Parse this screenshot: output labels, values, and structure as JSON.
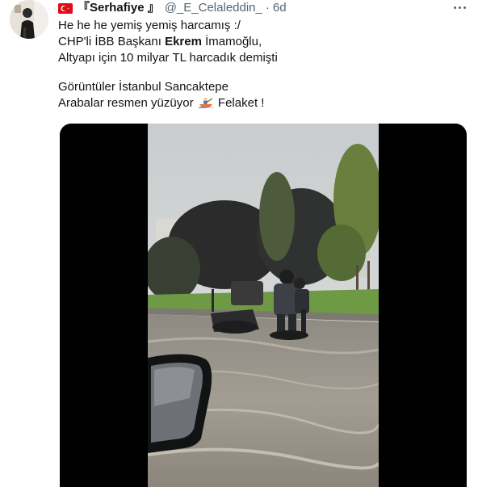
{
  "tweet": {
    "display_name": "『Serhafiye 』",
    "handle": "@_E_Celaleddin_",
    "separator": "·",
    "timestamp": "6d",
    "flag_icon": "turkey-flag-icon",
    "text_lines": {
      "l1": "He he he yemiş yemiş harcamış :/",
      "l2_pre": "CHP'li İBB Başkanı ",
      "l2_bold": "Ekrem",
      "l2_post": " İmamoğlu,",
      "l3": "Altyapı için 10 milyar TL harcadık demişti",
      "l4": "Görüntüler İstanbul Sancaktepe",
      "l5_pre": "Arabalar resmen yüzüyor ",
      "l5_emoji": "rowboat-emoji",
      "l5_post": " Felaket !"
    },
    "media": {
      "type": "video",
      "description_icon": "flooded-street-video"
    }
  },
  "colors": {
    "text_primary": "#0f1419",
    "text_secondary": "#536471",
    "flag_red": "#e30a17",
    "media_bg": "#000000"
  }
}
